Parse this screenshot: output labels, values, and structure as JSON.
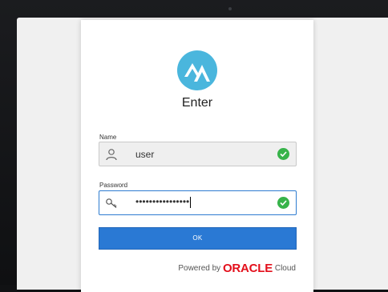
{
  "title": "Enter",
  "name_field": {
    "label": "Name",
    "value": "user"
  },
  "password_field": {
    "label": "Password",
    "value": "••••••••••••••••"
  },
  "ok_button": "OK",
  "footer": {
    "powered_by": "Powered by",
    "brand": "ORACLE",
    "suffix": "Cloud"
  },
  "colors": {
    "accent": "#2a79d4",
    "check": "#37b34a",
    "oracle_red": "#e30f1b",
    "logo": "#4ab6dd"
  },
  "icons": {
    "logo": "mountain-logo-icon",
    "name": "user-icon",
    "password": "key-icon",
    "valid": "check-circle-icon"
  }
}
